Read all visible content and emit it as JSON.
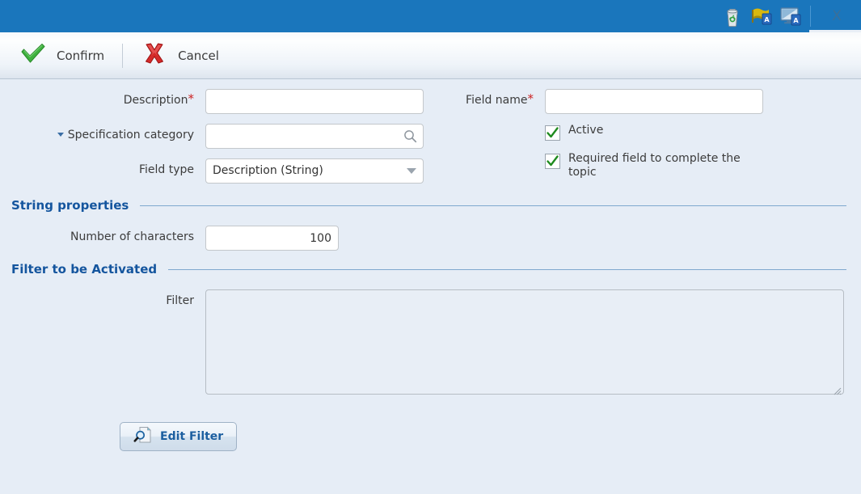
{
  "titlebar": {
    "background_color": "#1a76bc",
    "icons": [
      {
        "name": "recycle-bin-icon",
        "title": "Recycle bin"
      },
      {
        "name": "flag-attachment-icon",
        "title": "Flag"
      },
      {
        "name": "monitor-attachment-icon",
        "title": "Display"
      }
    ],
    "close_label": "X"
  },
  "toolbar": {
    "confirm_label": "Confirm",
    "cancel_label": "Cancel"
  },
  "form": {
    "description": {
      "label": "Description",
      "required_marker": "*",
      "value": "",
      "placeholder": ""
    },
    "specification_category": {
      "label": "Specification category",
      "value": "",
      "placeholder": ""
    },
    "field_type": {
      "label": "Field type",
      "value": "Description (String)",
      "options": [
        "Description (String)"
      ]
    },
    "field_name": {
      "label": "Field name",
      "required_marker": "*",
      "value": "",
      "placeholder": ""
    },
    "active": {
      "label": "Active",
      "checked": true
    },
    "required_field": {
      "label": "Required field to complete the topic",
      "checked": true
    }
  },
  "string_properties": {
    "section_title": "String properties",
    "number_of_characters": {
      "label": "Number of characters",
      "value": "100"
    }
  },
  "filter_section": {
    "section_title": "Filter to be Activated",
    "filter": {
      "label": "Filter",
      "value": "",
      "placeholder": ""
    },
    "edit_filter_button": "Edit Filter"
  },
  "colors": {
    "titlebar_blue": "#1a76bc",
    "page_background": "#e6edf6",
    "section_heading": "#14559e",
    "required_asterisk": "#cc2222",
    "button_text": "#1c5fa0",
    "checkmark_green": "#1f8b1f"
  }
}
